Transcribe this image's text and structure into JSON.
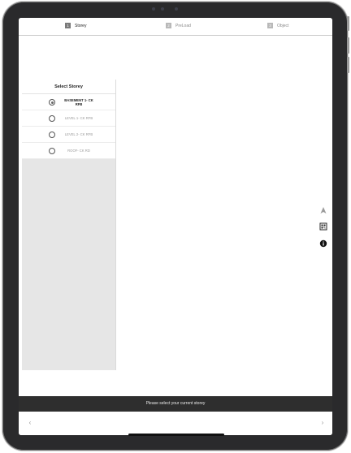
{
  "tabs": [
    {
      "number": "1",
      "label": "Storey",
      "active": true
    },
    {
      "number": "2",
      "label": "PreLoad",
      "active": false
    },
    {
      "number": "3",
      "label": "Object",
      "active": false
    }
  ],
  "storey_panel": {
    "title": "Select Storey",
    "items": [
      {
        "label": "BASEMENT 1- CK RFB",
        "selected": true
      },
      {
        "label": "LEVEL 1- CK RFB",
        "selected": false
      },
      {
        "label": "LEVEL 2- CK RFB",
        "selected": false
      },
      {
        "label": "ROOF- CK RD",
        "selected": false
      }
    ]
  },
  "tools": [
    "navigation-arrow-icon",
    "qr-code-icon",
    "info-icon"
  ],
  "status_message": "Please select your current storey",
  "nav": {
    "back_icon": "chevron-left-icon",
    "forward_icon": "chevron-right-icon"
  }
}
